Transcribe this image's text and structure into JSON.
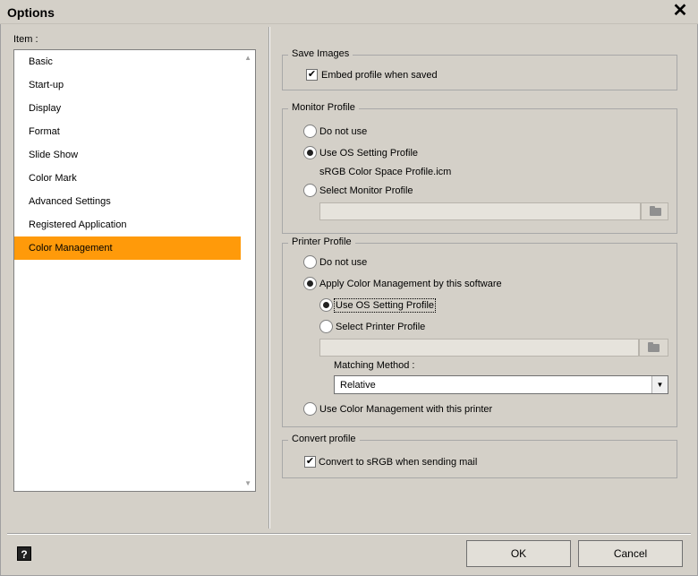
{
  "window": {
    "title": "Options",
    "close_glyph": "✕"
  },
  "sidebar": {
    "label": "Item :",
    "items": [
      {
        "label": "Basic"
      },
      {
        "label": "Start-up"
      },
      {
        "label": "Display"
      },
      {
        "label": "Format"
      },
      {
        "label": "Slide Show"
      },
      {
        "label": "Color Mark"
      },
      {
        "label": "Advanced Settings"
      },
      {
        "label": "Registered Application"
      },
      {
        "label": "Color Management",
        "selected": true
      }
    ]
  },
  "save_images": {
    "legend": "Save Images",
    "embed_profile": {
      "label": "Embed profile when saved",
      "checked": true
    }
  },
  "monitor_profile": {
    "legend": "Monitor Profile",
    "do_not_use": "Do not use",
    "use_os": "Use OS Setting Profile",
    "os_profile_name": "sRGB Color Space Profile.icm",
    "select_monitor": "Select Monitor Profile",
    "selected": "use_os"
  },
  "printer_profile": {
    "legend": "Printer Profile",
    "do_not_use": "Do not use",
    "apply_cm": "Apply Color Management by this software",
    "use_os": "Use OS Setting Profile",
    "select_printer": "Select Printer Profile",
    "matching_label": "Matching Method :",
    "matching_value": "Relative",
    "use_printer_cm": "Use Color Management with this printer",
    "selected": "apply_cm",
    "sub_selected": "use_os"
  },
  "convert_profile": {
    "legend": "Convert profile",
    "convert_srgb": {
      "label": "Convert to sRGB when sending mail",
      "checked": true
    }
  },
  "footer": {
    "help_glyph": "?",
    "ok_label": "OK",
    "cancel_label": "Cancel"
  },
  "colors": {
    "selection": "#ff9a0a",
    "background": "#d4d0c8"
  }
}
